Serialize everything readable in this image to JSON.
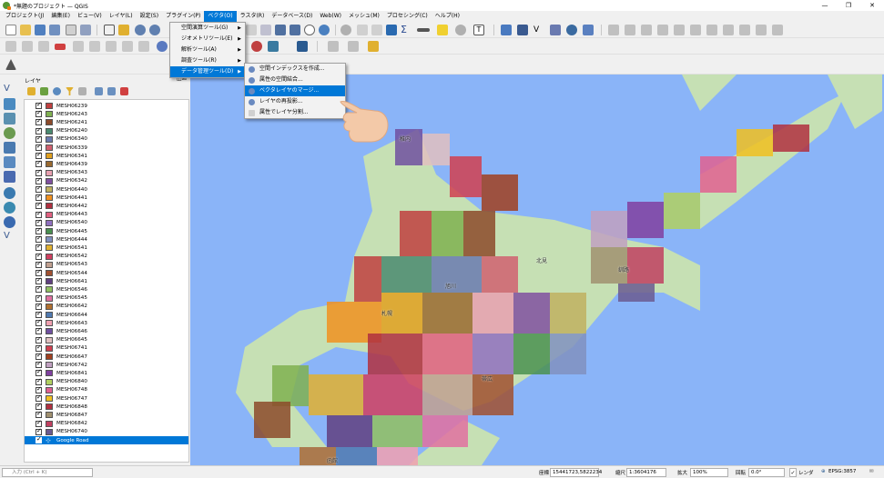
{
  "window": {
    "title": "*無題のプロジェクト — QGIS"
  },
  "menubar": [
    "プロジェクト(J)",
    "編集(E)",
    "ビュー(V)",
    "レイヤ(L)",
    "設定(S)",
    "プラグイン(P)",
    "ベクタ(O)",
    "ラスタ(R)",
    "データベース(D)",
    "Web(W)",
    "メッシュ(M)",
    "プロセシング(C)",
    "ヘルプ(H)"
  ],
  "vector_menu": [
    {
      "label": "空間演算ツール(G)",
      "arrow": true
    },
    {
      "label": "ジオメトリツール(E)",
      "arrow": true
    },
    {
      "label": "解析ツール(A)",
      "arrow": true
    },
    {
      "label": "調査ツール(R)",
      "arrow": true
    },
    {
      "label": "データ管理ツール(D)",
      "arrow": true
    }
  ],
  "data_mgmt_submenu": [
    {
      "label": "空間インデックスを作成...",
      "icon": "gear-icon"
    },
    {
      "label": "属性の空間結合...",
      "icon": "gear-icon"
    },
    {
      "label": "ベクタレイヤのマージ...",
      "icon": "gear-icon"
    },
    {
      "label": "レイヤの再投影...",
      "icon": "gear-icon"
    },
    {
      "label": "属性でレイヤ分割...",
      "icon": "table-icon"
    }
  ],
  "layers_panel": {
    "title": "レイヤ",
    "controls": "◫☒",
    "layers": [
      {
        "name": "MESH06239",
        "color": "#c04040"
      },
      {
        "name": "MESH06243",
        "color": "#7fb050"
      },
      {
        "name": "MESH06241",
        "color": "#8c4a2a"
      },
      {
        "name": "MESH06240",
        "color": "#4a8a70"
      },
      {
        "name": "MESH06340",
        "color": "#6a7ab0"
      },
      {
        "name": "MESH06339",
        "color": "#d06070"
      },
      {
        "name": "MESH06341",
        "color": "#e0a020"
      },
      {
        "name": "MESH06439",
        "color": "#9a6a30"
      },
      {
        "name": "MESH06343",
        "color": "#e8a0b0"
      },
      {
        "name": "MESH06342",
        "color": "#8050a0"
      },
      {
        "name": "MESH06440",
        "color": "#c0b060"
      },
      {
        "name": "MESH06441",
        "color": "#f09020"
      },
      {
        "name": "MESH06442",
        "color": "#b03040"
      },
      {
        "name": "MESH06443",
        "color": "#e06080"
      },
      {
        "name": "MESH06540",
        "color": "#9070c0"
      },
      {
        "name": "MESH06445",
        "color": "#4a9050"
      },
      {
        "name": "MESH06444",
        "color": "#8090c0"
      },
      {
        "name": "MESH06541",
        "color": "#e0b030"
      },
      {
        "name": "MESH06542",
        "color": "#d04060"
      },
      {
        "name": "MESH06543",
        "color": "#c0a090"
      },
      {
        "name": "MESH06544",
        "color": "#a05030"
      },
      {
        "name": "MESH06641",
        "color": "#604080"
      },
      {
        "name": "MESH06546",
        "color": "#90c060"
      },
      {
        "name": "MESH06545",
        "color": "#e070a0"
      },
      {
        "name": "MESH06642",
        "color": "#b07030"
      },
      {
        "name": "MESH06644",
        "color": "#507ab0"
      },
      {
        "name": "MESH06643",
        "color": "#f0a0b0"
      },
      {
        "name": "MESH06646",
        "color": "#7050a0"
      },
      {
        "name": "MESH06645",
        "color": "#e0c0c0"
      },
      {
        "name": "MESH06741",
        "color": "#d04050"
      },
      {
        "name": "MESH06647",
        "color": "#a04020"
      },
      {
        "name": "MESH06742",
        "color": "#c0a0c0"
      },
      {
        "name": "MESH06841",
        "color": "#8040a0"
      },
      {
        "name": "MESH06840",
        "color": "#b0d060"
      },
      {
        "name": "MESH06748",
        "color": "#e06090"
      },
      {
        "name": "MESH06747",
        "color": "#f0c020"
      },
      {
        "name": "MESH06848",
        "color": "#b03040"
      },
      {
        "name": "MESH06847",
        "color": "#a09070"
      },
      {
        "name": "MESH06842",
        "color": "#c04060"
      },
      {
        "name": "MESH06740",
        "color": "#6a5a90"
      },
      {
        "name": "Google Road",
        "color": "",
        "selected": true
      }
    ]
  },
  "status": {
    "search_placeholder": "入力 (Ctrl + K)",
    "coord_label": "座標",
    "coord_value": "15441723,5822234",
    "scale_label": "縮尺",
    "scale_value": "1:3604176",
    "magnifier_label": "拡大",
    "magnifier_value": "100%",
    "rotation_label": "回転",
    "rotation_value": "0.0°",
    "render_label": "レンダ",
    "crs": "EPSG:3857"
  },
  "map_labels": [
    "札幌",
    "旭川",
    "稚内",
    "帯広",
    "函館",
    "釧路",
    "北見"
  ],
  "colors": {
    "highlight": "#0078d7",
    "sea": "#8ab4f8",
    "land": "#c6e0b4"
  }
}
